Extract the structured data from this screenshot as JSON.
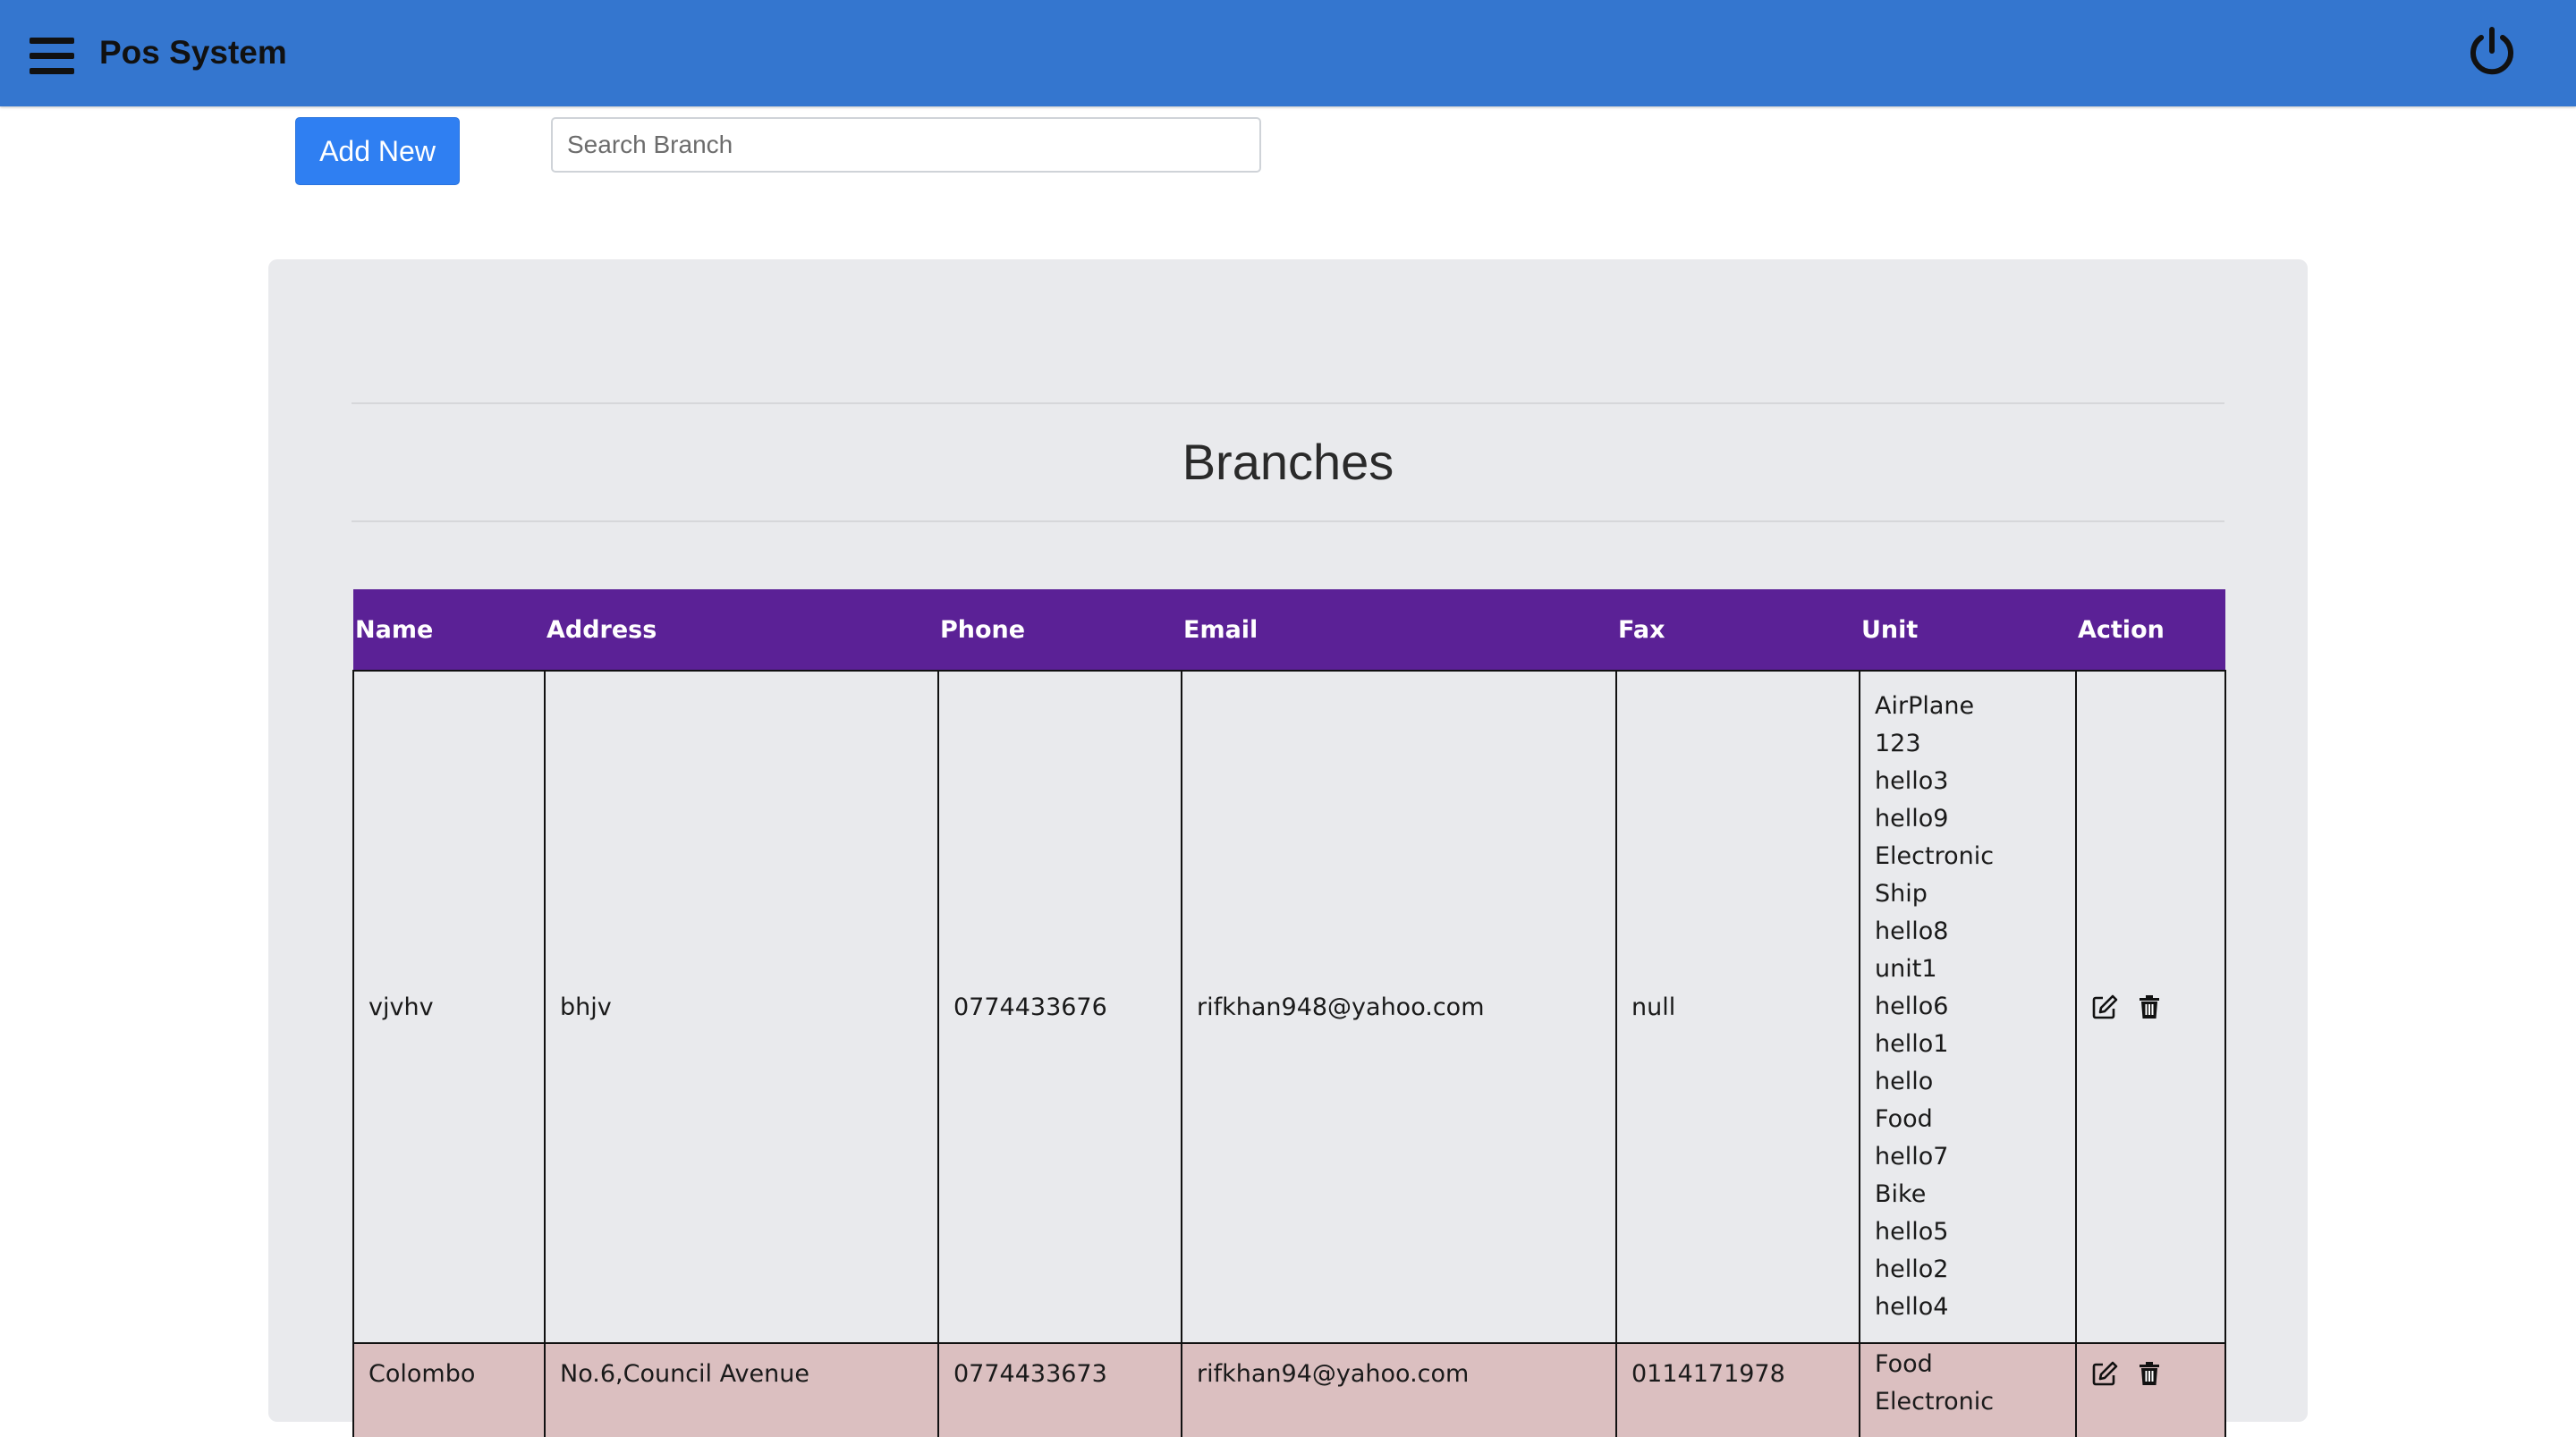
{
  "header": {
    "app_title": "Pos System"
  },
  "toolbar": {
    "add_new_label": "Add New",
    "search_placeholder": "Search Branch",
    "search_value": ""
  },
  "main": {
    "title": "Branches"
  },
  "table": {
    "columns": [
      "Name",
      "Address",
      "Phone",
      "Email",
      "Fax",
      "Unit",
      "Action"
    ],
    "rows": [
      {
        "name": "vjvhv",
        "address": "bhjv",
        "phone": "0774433676",
        "email": "rifkhan948@yahoo.com",
        "fax": "null",
        "units": [
          "AirPlane",
          "123",
          "hello3",
          "hello9",
          "Electronic",
          "Ship",
          "hello8",
          "unit1",
          "hello6",
          "hello1",
          "hello",
          "Food",
          "hello7",
          "Bike",
          "hello5",
          "hello2",
          "hello4"
        ]
      },
      {
        "name": "Colombo",
        "address": "No.6,Council Avenue",
        "phone": "0774433673",
        "email": "rifkhan94@yahoo.com",
        "fax": "0114171978",
        "units": [
          "Food",
          "Electronic"
        ]
      }
    ]
  },
  "icons": {
    "menu": "hamburger-icon",
    "power": "power-icon",
    "edit": "edit-icon",
    "delete": "trash-icon"
  },
  "colors": {
    "topbar": "#3476cf",
    "primary_button": "#2f7ff2",
    "table_header": "#5b2196",
    "row_alt": "#dbbfc0",
    "panel": "#e9eaed"
  }
}
